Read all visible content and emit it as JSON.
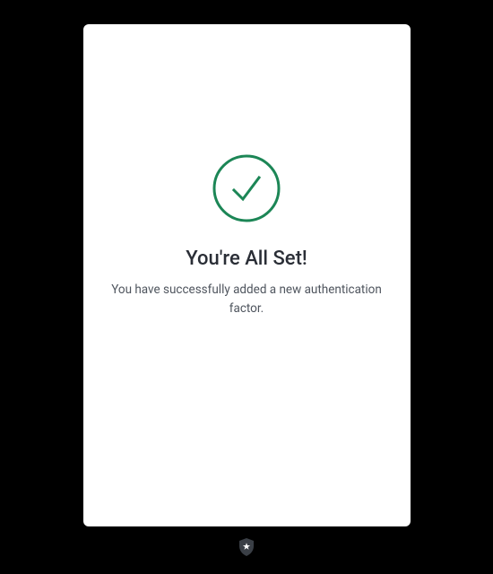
{
  "confirmation": {
    "title": "You're All Set!",
    "message": "You have successfully added a new authentication factor."
  },
  "colors": {
    "accent": "#1C8656",
    "background": "#000000",
    "card": "#ffffff"
  }
}
